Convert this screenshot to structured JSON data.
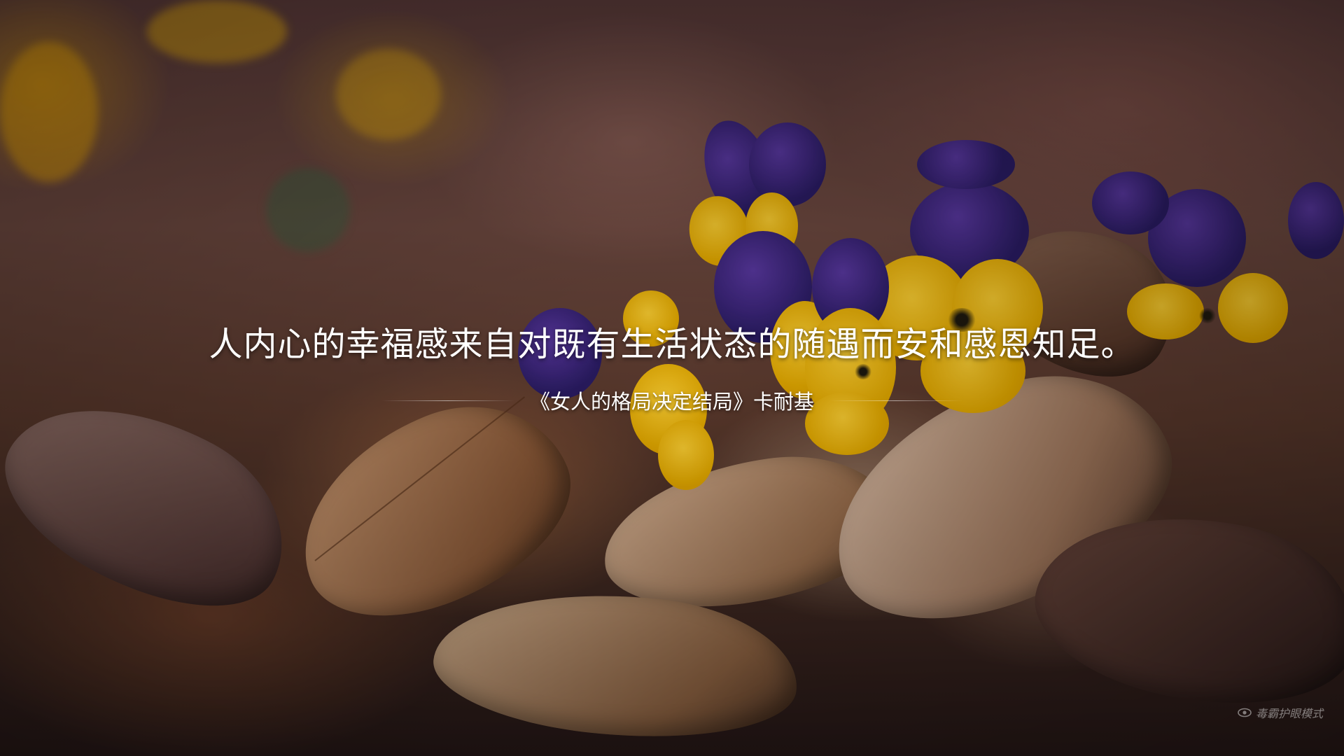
{
  "slide": {
    "quote": "人内心的幸福感来自对既有生活状态的随遇而安和感恩知足。",
    "attribution": "《女人的格局决定结局》卡耐基"
  },
  "overlay": {
    "eyecare_label": "毒霸护眼模式",
    "eyecare_icon": "eye-icon"
  },
  "colors": {
    "text": "#ffffff",
    "flower_purple": "#2b1c63",
    "flower_yellow": "#ffd23a",
    "leaf_brown": "#8a5a3a"
  }
}
